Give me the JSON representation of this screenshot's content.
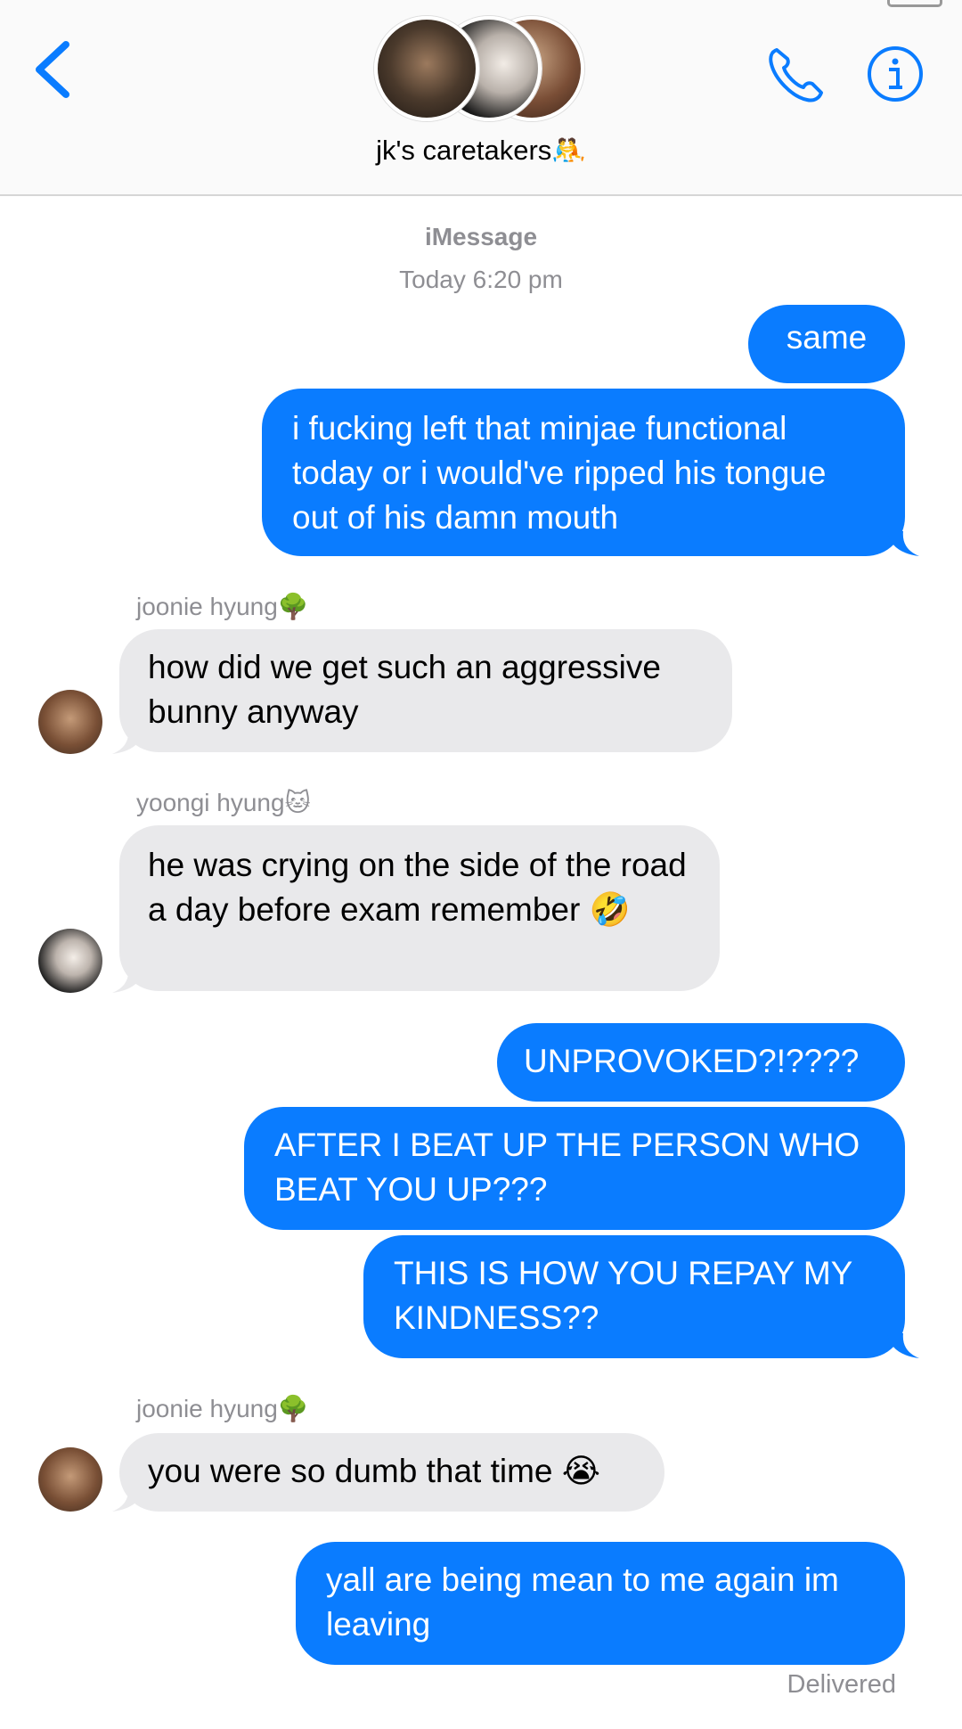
{
  "header": {
    "title": "jk's caretakers🤼",
    "colors": {
      "accent": "#0a7cff",
      "nav_background": "#fafafa"
    },
    "icons": [
      "back-chevron-icon",
      "phone-icon",
      "info-icon"
    ]
  },
  "conversation": {
    "service": "iMessage",
    "timestamp": "Today 6:20 pm",
    "delivered_label": "Delivered",
    "messages": [
      {
        "from": "me",
        "text": "same"
      },
      {
        "from": "me",
        "text": "i fucking left that minjae functional today or i would've ripped his tongue out of his damn mouth"
      },
      {
        "from": "joonie hyung🌳",
        "text": "how did we get such an aggressive bunny anyway"
      },
      {
        "from": "yoongi hyung🐱",
        "text": "he was crying on the side of the road a day before exam remember 🤣"
      },
      {
        "from": "me",
        "text": "UNPROVOKED?!????"
      },
      {
        "from": "me",
        "text": "AFTER I BEAT UP THE PERSON WHO BEAT YOU UP???"
      },
      {
        "from": "me",
        "text": "THIS IS HOW YOU REPAY MY KINDNESS??"
      },
      {
        "from": "joonie hyung🌳",
        "text": "you were so dumb that time 😭"
      },
      {
        "from": "me",
        "text": "yall are being mean to me again im leaving"
      }
    ],
    "sender_names": {
      "joonie": "joonie hyung🌳",
      "yoongi": "yoongi hyung🐱"
    },
    "colors": {
      "outgoing_bubble": "#0a7cff",
      "incoming_bubble": "#e9e9eb",
      "meta_text": "#8e8e93"
    }
  }
}
